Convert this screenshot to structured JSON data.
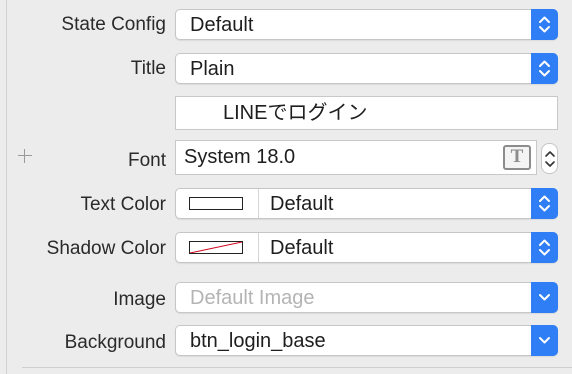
{
  "inspector": {
    "state_config": {
      "label": "State Config",
      "value": "Default"
    },
    "title": {
      "label": "Title",
      "value": "Plain"
    },
    "title_text": {
      "value": "LINEでログイン"
    },
    "font": {
      "label": "Font",
      "value": "System 18.0",
      "t_glyph": "T"
    },
    "text_color": {
      "label": "Text Color",
      "value": "Default",
      "swatch": "#ffffff"
    },
    "shadow_color": {
      "label": "Shadow Color",
      "value": "Default",
      "swatch": "clear"
    },
    "image": {
      "label": "Image",
      "placeholder": "Default Image"
    },
    "background": {
      "label": "Background",
      "value": "btn_login_base"
    }
  },
  "icons": {
    "add": "plus-icon",
    "popup_stepper": "up-down-chevron-icon",
    "dropdown": "chevron-down-icon",
    "font_picker": "font-t-icon"
  },
  "colors": {
    "accent": "#2f7ef6"
  }
}
